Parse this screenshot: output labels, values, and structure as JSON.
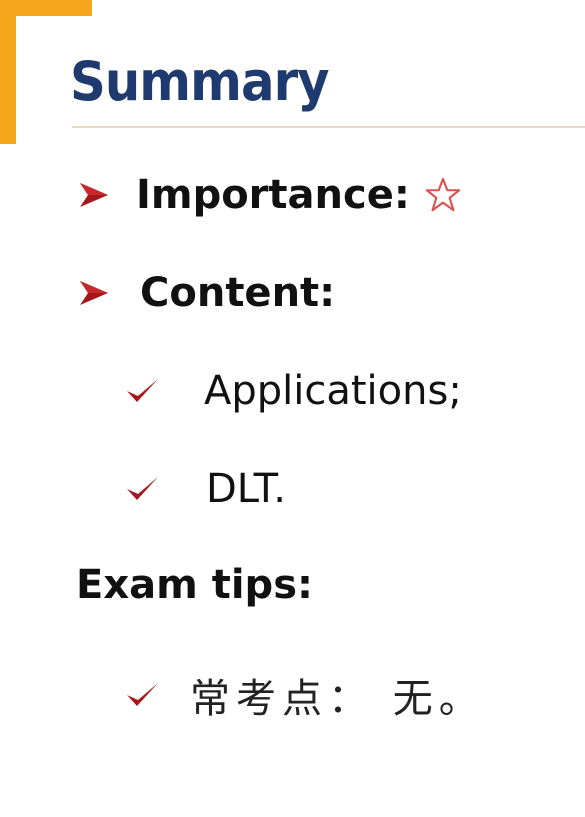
{
  "header": {
    "title": "Summary"
  },
  "bullets": [
    {
      "label": "Importance:",
      "icon": "star-outline-icon"
    },
    {
      "label": "Content:"
    }
  ],
  "content_items": [
    "Applications;",
    "DLT."
  ],
  "exam": {
    "heading": "Exam tips:",
    "item": "常考点： 无。"
  },
  "colors": {
    "accent_orange": "#f5a51a",
    "title_navy": "#1f3a6e",
    "bullet_red": "#a4161a",
    "star_red": "#d9534f"
  }
}
